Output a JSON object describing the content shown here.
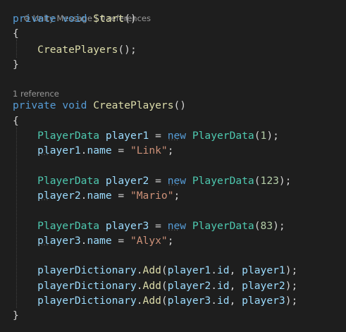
{
  "codelens": {
    "start_method": [
      "Unity Message",
      "0 references"
    ],
    "create_players_method": "1 reference",
    "separator": " | "
  },
  "code": {
    "start_signature": {
      "modifier": "private",
      "return_type": "void",
      "name": "Start",
      "params": "()"
    },
    "open_brace": "{",
    "close_brace": "}",
    "start_body": {
      "call": "CreatePlayers",
      "args": "();"
    },
    "create_players_signature": {
      "modifier": "private",
      "return_type": "void",
      "name": "CreatePlayers",
      "params": "()"
    },
    "players": [
      {
        "type": "PlayerData",
        "var": "player1",
        "new_kw": "new",
        "ctor": "PlayerData",
        "arg": "1",
        "field": "name",
        "value": "\"Link\""
      },
      {
        "type": "PlayerData",
        "var": "player2",
        "new_kw": "new",
        "ctor": "PlayerData",
        "arg": "123",
        "field": "name",
        "value": "\"Mario\""
      },
      {
        "type": "PlayerData",
        "var": "player3",
        "new_kw": "new",
        "ctor": "PlayerData",
        "arg": "83",
        "field": "name",
        "value": "\"Alyx\""
      }
    ],
    "dictionary_adds": [
      {
        "dict": "playerDictionary",
        "method": "Add",
        "key_obj": "player1",
        "key_field": "id",
        "value": "player1"
      },
      {
        "dict": "playerDictionary",
        "method": "Add",
        "key_obj": "player2",
        "key_field": "id",
        "value": "player2"
      },
      {
        "dict": "playerDictionary",
        "method": "Add",
        "key_obj": "player3",
        "key_field": "id",
        "value": "player3"
      }
    ],
    "punct": {
      "eq": " = ",
      "open_paren": "(",
      "close_paren_semi": ");",
      "dot": ".",
      "semi": ";",
      "comma": ", "
    }
  },
  "colors": {
    "background": "#1e1e1e",
    "keyword": "#569cd6",
    "type": "#4ec9b0",
    "method": "#dcdcaa",
    "variable": "#9cdcfe",
    "number": "#b5cea8",
    "string": "#ce9178",
    "punctuation": "#d4d4d4",
    "codelens": "#999999"
  },
  "icons": {
    "unity_message": "gear-icon"
  }
}
